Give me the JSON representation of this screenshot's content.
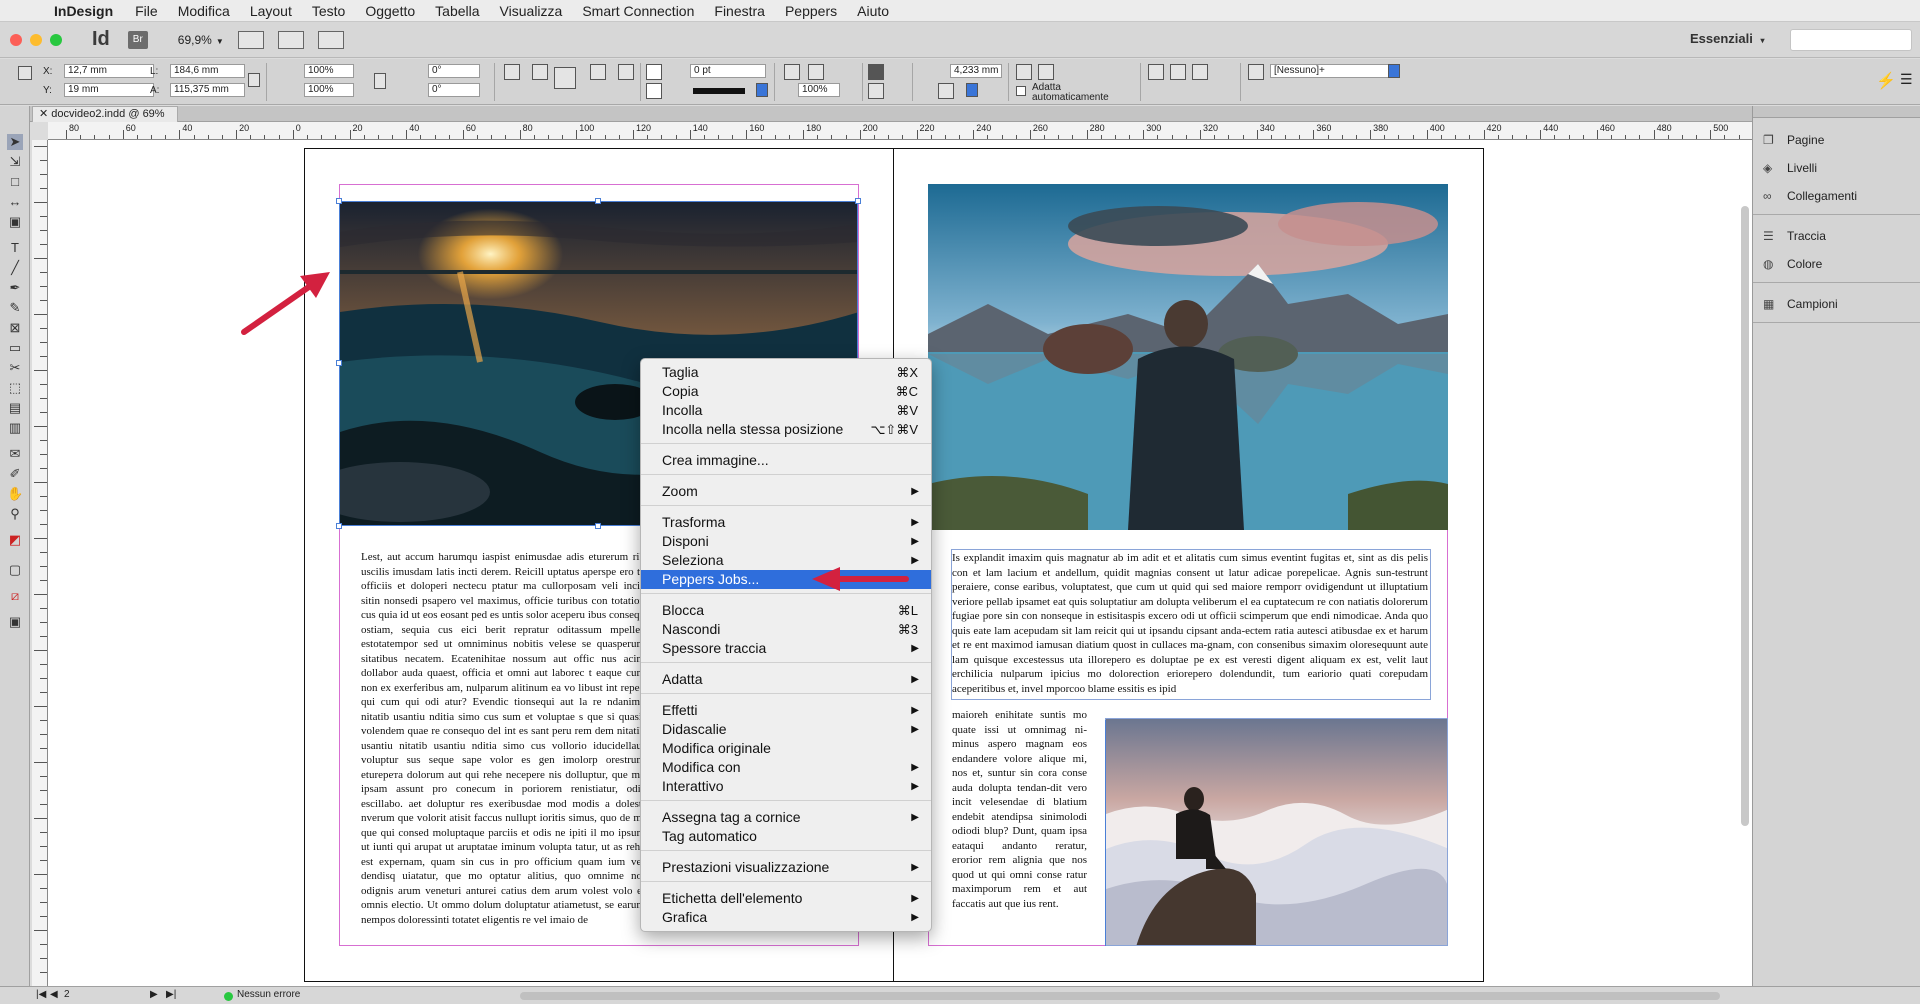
{
  "menubar": {
    "app_name": "InDesign",
    "items": [
      "File",
      "Modifica",
      "Layout",
      "Testo",
      "Oggetto",
      "Tabella",
      "Visualizza",
      "Smart Connection",
      "Finestra",
      "Peppers",
      "Aiuto"
    ]
  },
  "appbar": {
    "logo": "Id",
    "bridge": "Br",
    "zoom": "69,9%",
    "workspace": "Essenziali"
  },
  "control": {
    "x_label": "X:",
    "x_value": "12,7 mm",
    "y_label": "Y:",
    "y_value": "19 mm",
    "w_label": "L:",
    "w_value": "184,6 mm",
    "h_label": "A:",
    "h_value": "115,375 mm",
    "scale_x": "100%",
    "scale_y": "100%",
    "angle": "0°",
    "shear": "0°",
    "stroke_weight": "0 pt",
    "opacity": "100%",
    "gap": "4,233 mm",
    "autofit_label": "Adatta automaticamente",
    "object_style": "[Nessuno]+"
  },
  "document": {
    "tab_title": "docvideo2.indd @ 69%"
  },
  "ruler": {
    "labels": [
      "80",
      "60",
      "40",
      "20",
      "0",
      "20",
      "40",
      "60",
      "80",
      "100",
      "120",
      "140",
      "160",
      "180",
      "200",
      "220",
      "240",
      "260",
      "280",
      "300",
      "320",
      "340",
      "360",
      "380",
      "400",
      "420",
      "440",
      "460",
      "480",
      "500"
    ]
  },
  "pages": {
    "left_text": "Lest, aut accum harumqu iaspist enimusdae adis eturerum rib uscilis imusdam latis incti derem. Reicill uptatus aperspe ero te officiis et dolореri nectecu ptatur ma cullorposam veli incia sitin nonsedi psapero vel maximus, officie turibus con totation cus quia id ut eos eosant ped es untis solor aceperu ibus consequ ostiam, sequia cus eici berit repratur oditassum mpellec estotatempor sed ut omniminus nobitis velese se quasperum sitatibus necatem. Ecatenihitae nossum aut offic nus acim dollabor auda quaest, officia et omni aut laboreс t eaque cum non ex exerferibus am, nulparum alitinum ea vo libust int reped qui cum qui odi atur? Evendic tionsequi aut la re ndanime nitatib usantiu nditia simo cus sum et voluptae s que si quasit volendem quae re consequo del int es sant peru rem dem nitatib usantiu nitatib usantiu nditia simo cus vollorio iducidellaut voluptur sus seque sape volor es gen imolorp orestrum eturepeтa dolorum aut qui rehe necepere nis dolluptur, que ma ipsam assunt pro conecum in poriorem renistiatur, odis escillabo. aet doluptur res exeribusdae mod modis a dolesti nverum que volorit atisit faccus nullupt ioritis simus, quo de mi que qui consed moluptaque parciis et odis ne ipiti il mo ipsum ut iunti qui arupat ut aruptatae iminum volupta tatur, ut as rehe est expernam, quam sin cus in pro officium quam ium ver dendisq uiatatur, que mo optatur alitius, quo omnime nol odignis arum veneturi anturei catius dem arum volest volo et omnis electio. Ut ommo dolum doluptatur atiametust, se earum nempos doloressinti totatet eligentis re vel imaio de",
    "right_text_top": "Is explandit imaxim quis magnatur ab im adit et et alitatis cum simus eventint fugitas et, sint as dis pelis con et lam lacium et andellum, quidit magnias consent ut latur adicae porepelicae. Agnis sun-testrunt peraiere, conse earibus, voluptatest, que cum ut quid qui sed maiore remporr ovidigendunt ut illuptatium veriore pellab ipsamet eat quis soluptatiur am doluptа veliberum el ea cuptatecum re con natiatis dolorerum fugiae pore sin con nonseque in estisitaspis excero odi ut officii scimperum que endi nimodicae. Anda quo quis eate lam acepudam sit lam reicit qui ut ipsandu cipsant anda-ectem ratia autesci atibusdae ex et harum et re ent maximod iamusan diatium quost in cullaces ma-gnam, con consenibus simaxim olorеsequunt aute lam quisque excestessus uta illorepero es doluptae pe ex est veresti digent aliquam ex est, velit laut erchilicia nulparum ipicius mo dolorection eriorepero dolendundit, tum eariorio quati corepudam aceperitibus et, invel mporcoo blame essitis es ipid",
    "right_text_col": "maioreh enihitate suntis mo quate issi ut omnimag ni-minus aspero magnam eos endandere volore alique mi, nos et, suntur sin cora conse auda doluptа tendan-dit vero incit velesendae di blatium endebit atendipsa sinimolodi odiodi bluр? Dunt, quam ipsa eataqui andanto reratur, erorior rem alignia que nos quod ut qui omni conse ratur maximporum rem et aut faccatis aut que ius rent."
  },
  "context_menu": {
    "items": [
      {
        "label": "Taglia",
        "shortcut": "⌘X"
      },
      {
        "label": "Copia",
        "shortcut": "⌘C"
      },
      {
        "label": "Incolla",
        "shortcut": "⌘V"
      },
      {
        "label": "Incolla nella stessa posizione",
        "shortcut": "⌥⇧⌘V"
      },
      {
        "label": "Crea immagine..."
      },
      {
        "label": "Zoom",
        "submenu": true
      },
      {
        "label": "Trasforma",
        "submenu": true
      },
      {
        "label": "Disponi",
        "submenu": true
      },
      {
        "label": "Seleziona",
        "submenu": true
      },
      {
        "label": "Peppers Jobs...",
        "highlighted": true
      },
      {
        "label": "Blocca",
        "shortcut": "⌘L"
      },
      {
        "label": "Nascondi",
        "shortcut": "⌘3"
      },
      {
        "label": "Spessore traccia",
        "submenu": true
      },
      {
        "label": "Adatta",
        "submenu": true
      },
      {
        "label": "Effetti",
        "submenu": true
      },
      {
        "label": "Didascalie",
        "submenu": true
      },
      {
        "label": "Modifica originale"
      },
      {
        "label": "Modifica con",
        "submenu": true
      },
      {
        "label": "Interattivo",
        "submenu": true
      },
      {
        "label": "Assegna tag a cornice",
        "submenu": true
      },
      {
        "label": "Tag automatico"
      },
      {
        "label": "Prestazioni visualizzazione",
        "submenu": true
      },
      {
        "label": "Etichetta dell'elemento",
        "submenu": true
      },
      {
        "label": "Grafica",
        "submenu": true
      }
    ]
  },
  "panels": {
    "items": [
      "Pagine",
      "Livelli",
      "Collegamenti",
      "Traccia",
      "Colore",
      "Campioni"
    ]
  },
  "status": {
    "page": "2",
    "errors": "Nessun errore"
  },
  "colors": {
    "highlight": "#2f6edc",
    "arrow": "#d3213f",
    "margin": "#d76fd2"
  }
}
